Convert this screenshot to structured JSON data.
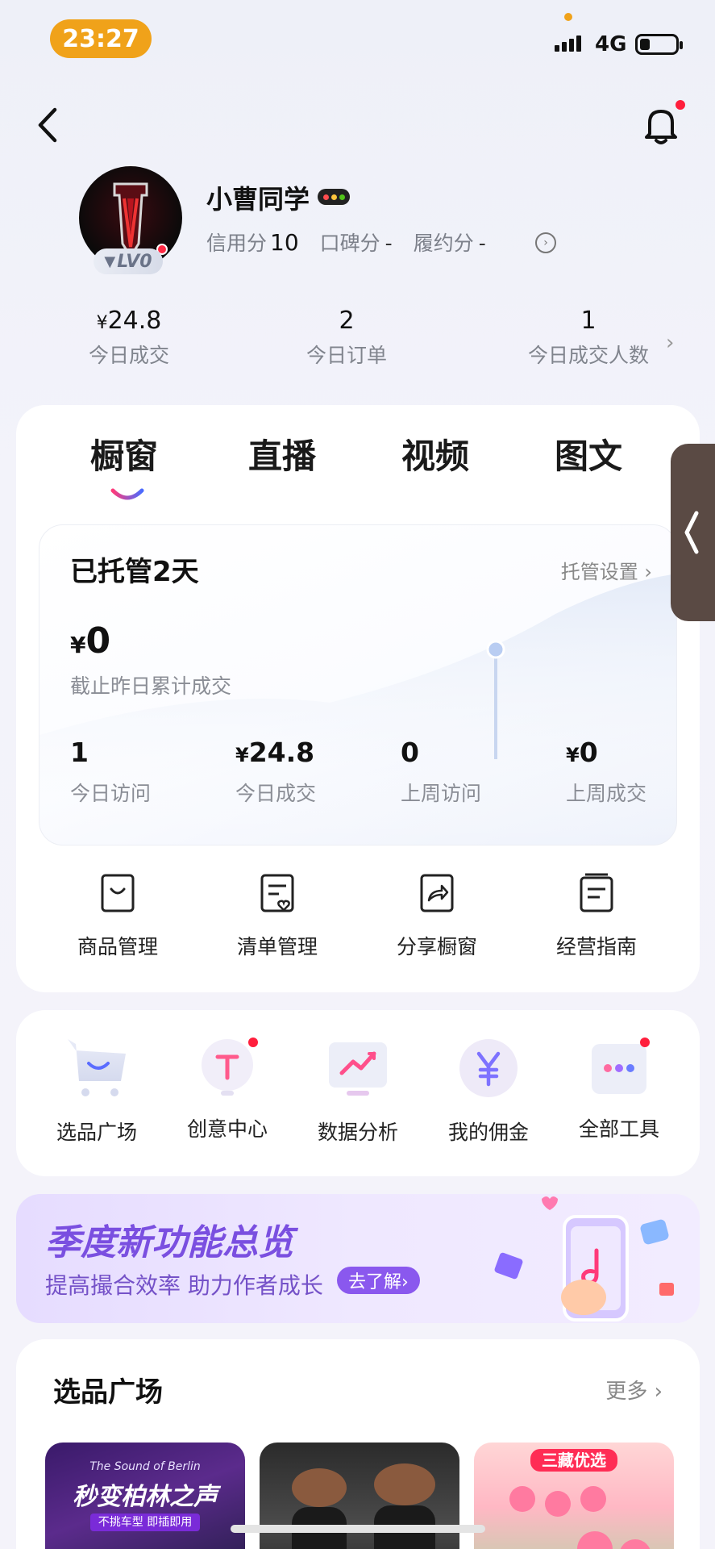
{
  "status_bar": {
    "time": "23:27",
    "network": "4G"
  },
  "profile": {
    "name": "小曹同学",
    "level_badge": "LV0",
    "credit_label": "信用分",
    "credit_value": "10",
    "reputation_label": "口碑分",
    "reputation_value": "-",
    "contract_label": "履约分",
    "contract_value": "-"
  },
  "stats": [
    {
      "currency": "¥",
      "value": "24.8",
      "label": "今日成交"
    },
    {
      "currency": "",
      "value": "2",
      "label": "今日订单"
    },
    {
      "currency": "",
      "value": "1",
      "label": "今日成交人数"
    }
  ],
  "tabs": [
    {
      "label": "橱窗",
      "active": true
    },
    {
      "label": "直播",
      "active": false
    },
    {
      "label": "视频",
      "active": false
    },
    {
      "label": "图文",
      "active": false
    }
  ],
  "managed": {
    "title": "已托管2天",
    "settings": "托管设置 ›",
    "total_currency": "¥",
    "total_value": "0",
    "total_label": "截止昨日累计成交",
    "metrics": [
      {
        "currency": "",
        "value": "1",
        "label": "今日访问"
      },
      {
        "currency": "¥",
        "value": "24.8",
        "label": "今日成交"
      },
      {
        "currency": "",
        "value": "0",
        "label": "上周访问"
      },
      {
        "currency": "¥",
        "value": "0",
        "label": "上周成交"
      }
    ]
  },
  "actions": [
    {
      "label": "商品管理",
      "icon": "product-bag-icon"
    },
    {
      "label": "清单管理",
      "icon": "list-heart-icon"
    },
    {
      "label": "分享橱窗",
      "icon": "share-icon"
    },
    {
      "label": "经营指南",
      "icon": "guide-book-icon"
    }
  ],
  "tools": [
    {
      "label": "选品广场",
      "icon": "cart-icon",
      "dot": false
    },
    {
      "label": "创意中心",
      "icon": "creative-bulb-icon",
      "dot": true
    },
    {
      "label": "数据分析",
      "icon": "trend-chart-icon",
      "dot": false
    },
    {
      "label": "我的佣金",
      "icon": "yen-coin-icon",
      "dot": false
    },
    {
      "label": "全部工具",
      "icon": "more-tools-icon",
      "dot": true
    }
  ],
  "banner": {
    "title": "季度新功能总览",
    "subtitle": "提高撮合效率 助力作者成长",
    "button": "去了解›"
  },
  "selection": {
    "title": "选品广场",
    "more": "更多",
    "products": [
      {
        "headline": "The Sound of Berlin",
        "title": "秒变柏林之声",
        "tag": "不挑车型 即插即用"
      },
      {
        "headline": "",
        "title": "",
        "tag": ""
      },
      {
        "headline": "三藏优选",
        "title": "",
        "tag": ""
      }
    ]
  },
  "colors": {
    "accent_orange": "#f0a21a",
    "red_dot": "#ff1e3c",
    "banner_purple": "#7a4fe0"
  }
}
